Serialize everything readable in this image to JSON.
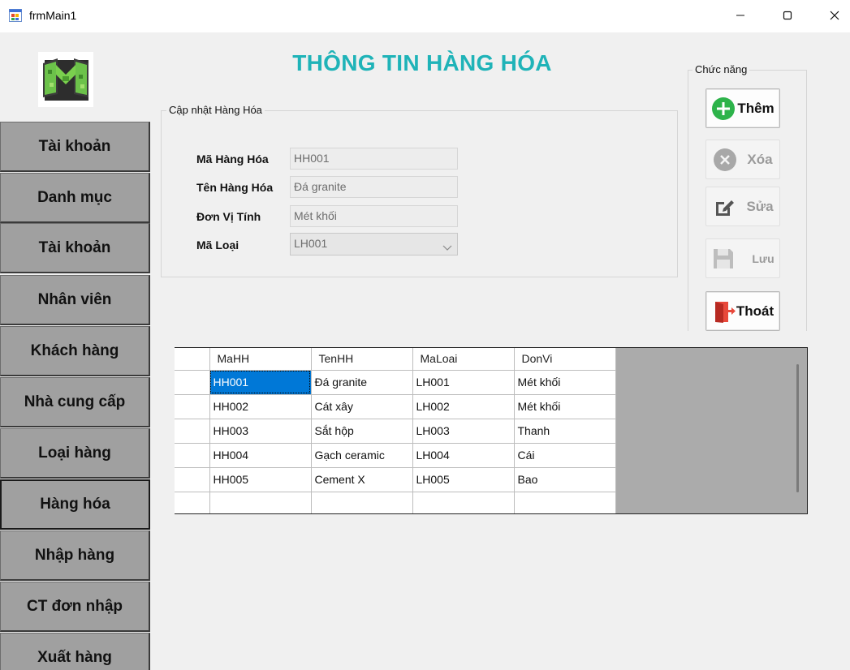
{
  "window": {
    "title": "frmMain1",
    "icon": "form-app-icon",
    "controls": [
      "minimize-icon",
      "maximize-icon",
      "close-icon"
    ]
  },
  "logo": {
    "icon": "minecraft-m-logo"
  },
  "sidebar": {
    "items": [
      {
        "label": "Tài khoản",
        "active": false
      },
      {
        "label": "Danh mục",
        "active": false
      },
      {
        "label": "Tài khoản",
        "active": false
      },
      {
        "label": "Nhân viên",
        "active": false
      },
      {
        "label": "Khách hàng",
        "active": false
      },
      {
        "label": "Nhà cung cấp",
        "active": false
      },
      {
        "label": "Loại hàng",
        "active": false
      },
      {
        "label": "Hàng hóa",
        "active": true
      },
      {
        "label": "Nhập hàng",
        "active": false
      },
      {
        "label": "CT đơn nhập",
        "active": false
      },
      {
        "label": "Xuất hàng",
        "active": false
      }
    ]
  },
  "heading": "THÔNG TIN HÀNG HÓA",
  "update_group": {
    "title": "Cập nhật Hàng Hóa",
    "fields": {
      "mahh": {
        "label": "Mã Hàng Hóa",
        "value": "HH001"
      },
      "tenhh": {
        "label": "Tên Hàng Hóa",
        "value": "Đá granite"
      },
      "donvi": {
        "label": "Đơn Vị Tính",
        "value": "Mét khối"
      },
      "maloai": {
        "label": "Mã Loại",
        "value": "LH001"
      }
    }
  },
  "function_group": {
    "title": "Chức năng",
    "buttons": {
      "them": {
        "label": "Thêm",
        "icon": "plus-circle-icon",
        "enabled": true
      },
      "xoa": {
        "label": "Xóa",
        "icon": "x-circle-icon",
        "enabled": false
      },
      "sua": {
        "label": "Sửa",
        "icon": "edit-icon",
        "enabled": false
      },
      "luu": {
        "label": "Lưu",
        "icon": "save-icon",
        "enabled": false
      },
      "thoat": {
        "label": "Thoát",
        "icon": "exit-door-icon",
        "enabled": true
      }
    }
  },
  "grid": {
    "columns": [
      "MaHH",
      "TenHH",
      "MaLoai",
      "DonVi"
    ],
    "rows": [
      [
        "HH001",
        "Đá granite",
        "LH001",
        "Mét khối"
      ],
      [
        "HH002",
        "Cát xây",
        "LH002",
        "Mét khối"
      ],
      [
        "HH003",
        "Sắt hộp",
        "LH003",
        "Thanh"
      ],
      [
        "HH004",
        "Gạch ceramic",
        "LH004",
        "Cái"
      ],
      [
        "HH005",
        "Cement X",
        "LH005",
        "Bao"
      ]
    ],
    "selected_cell": "HH001"
  },
  "colors": {
    "heading": "#1fb3b8",
    "sidebar_button": "#a0a0a0",
    "selection": "#0078d7",
    "grid_background": "#ababab"
  }
}
